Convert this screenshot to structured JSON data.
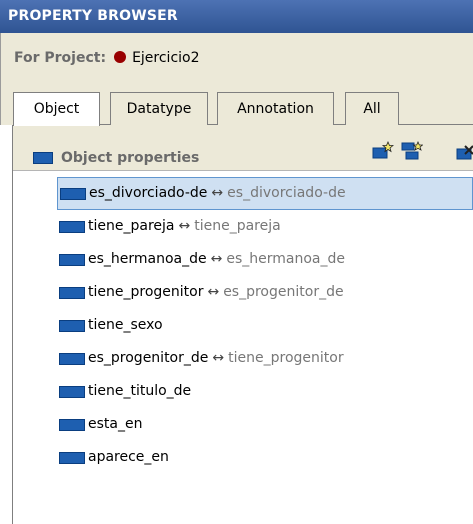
{
  "window": {
    "title": "PROPERTY BROWSER"
  },
  "project": {
    "label": "For Project:",
    "name": "Ejercicio2",
    "dot_color": "#990000"
  },
  "tabs": [
    {
      "label": "Object",
      "active": true
    },
    {
      "label": "Datatype",
      "active": false
    },
    {
      "label": "Annotation",
      "active": false
    },
    {
      "label": "All",
      "active": false
    }
  ],
  "panel": {
    "title": "Object properties",
    "tools": [
      "create-property-icon",
      "create-subproperty-icon",
      "delete-property-icon"
    ]
  },
  "properties": [
    {
      "name": "es_divorciado-de",
      "arrow": "↔",
      "inverse": "es_divorciado-de",
      "selected": true
    },
    {
      "name": "tiene_pareja",
      "arrow": "↔",
      "inverse": "tiene_pareja",
      "selected": false
    },
    {
      "name": "es_hermanoa_de",
      "arrow": "↔",
      "inverse": "es_hermanoa_de",
      "selected": false
    },
    {
      "name": "tiene_progenitor",
      "arrow": "↔",
      "inverse": "es_progenitor_de",
      "selected": false
    },
    {
      "name": "tiene_sexo",
      "arrow": "",
      "inverse": "",
      "selected": false
    },
    {
      "name": "es_progenitor_de",
      "arrow": "↔",
      "inverse": "tiene_progenitor",
      "selected": false
    },
    {
      "name": "tiene_titulo_de",
      "arrow": "",
      "inverse": "",
      "selected": false
    },
    {
      "name": "esta_en",
      "arrow": "",
      "inverse": "",
      "selected": false
    },
    {
      "name": "aparece_en",
      "arrow": "",
      "inverse": "",
      "selected": false
    }
  ],
  "colors": {
    "header": "#2f5493",
    "selection": "#cfe0f2",
    "property_icon": "#1e5fb0"
  }
}
